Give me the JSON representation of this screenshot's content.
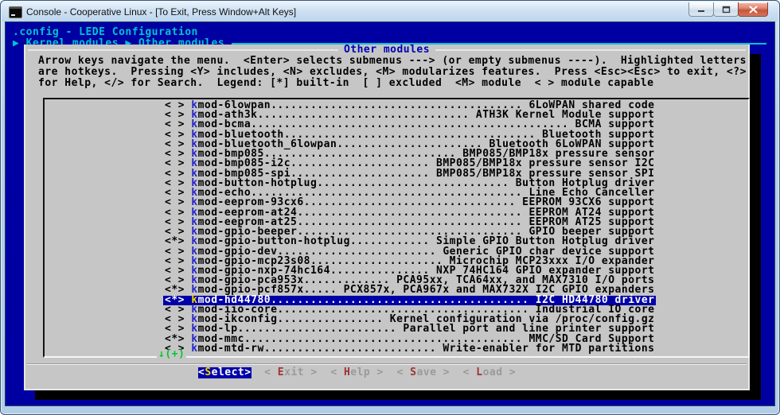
{
  "window": {
    "title": "Console - Cooperative Linux - [To Exit, Press Window+Alt Keys]"
  },
  "console": {
    "backtitle": ".config - LEDE Configuration",
    "breadcrumb": "▶ Kernel modules ▶ Other modules"
  },
  "dialog": {
    "title": "Other modules",
    "instructions": [
      "Arrow keys navigate the menu.  <Enter> selects submenus ---> (or empty submenus ----).  Highlighted letters",
      "are hotkeys.  Pressing <Y> includes, <N> excludes, <M> modularizes features.  Press <Esc><Esc> to exit, <?>",
      "for Help, </> for Search.  Legend: [*] built-in  [ ] excluded  <M> module  < > module capable"
    ],
    "list": {
      "line_width": 74,
      "more_below": "↓(+)",
      "items": [
        {
          "state": "< >",
          "name": "kmod-6lowpan",
          "desc": "6LoWPAN shared code"
        },
        {
          "state": "< >",
          "name": "kmod-ath3k",
          "desc": "ATH3K Kernel Module support"
        },
        {
          "state": "< >",
          "name": "kmod-bcma",
          "desc": "BCMA support"
        },
        {
          "state": "< >",
          "name": "kmod-bluetooth",
          "desc": "Bluetooth support"
        },
        {
          "state": "< >",
          "name": "kmod-bluetooth_6lowpan",
          "desc": "Bluetooth 6LoWPAN support"
        },
        {
          "state": "< >",
          "name": "kmod-bmp085",
          "desc": "BMP085/BMP18x pressure sensor"
        },
        {
          "state": "< >",
          "name": "kmod-bmp085-i2c",
          "desc": "BMP085/BMP18x pressure sensor I2C"
        },
        {
          "state": "< >",
          "name": "kmod-bmp085-spi",
          "desc": "BMP085/BMP18x pressure sensor SPI"
        },
        {
          "state": "< >",
          "name": "kmod-button-hotplug",
          "desc": "Button Hotplug driver"
        },
        {
          "state": "< >",
          "name": "kmod-echo",
          "desc": "Line Echo Canceller"
        },
        {
          "state": "< >",
          "name": "kmod-eeprom-93cx6",
          "desc": "EEPROM 93CX6 support"
        },
        {
          "state": "< >",
          "name": "kmod-eeprom-at24",
          "desc": "EEPROM AT24 support"
        },
        {
          "state": "< >",
          "name": "kmod-eeprom-at25",
          "desc": "EEPROM AT25 support"
        },
        {
          "state": "< >",
          "name": "kmod-gpio-beeper",
          "desc": "GPIO beeper support"
        },
        {
          "state": "<*>",
          "name": "kmod-gpio-button-hotplug",
          "desc": "Simple GPIO Button Hotplug driver"
        },
        {
          "state": "< >",
          "name": "kmod-gpio-dev",
          "desc": "Generic GPIO char device support"
        },
        {
          "state": "< >",
          "name": "kmod-gpio-mcp23s08",
          "desc": "Microchip MCP23xxx I/O expander"
        },
        {
          "state": "< >",
          "name": "kmod-gpio-nxp-74hc164",
          "desc": "NXP 74HC164 GPIO expander support"
        },
        {
          "state": "< >",
          "name": "kmod-gpio-pca953x",
          "desc": "PCA95xx, TCA64xx, and MAX7310 I/O ports"
        },
        {
          "state": "<*>",
          "name": "kmod-gpio-pcf857x",
          "desc": "PCX857x, PCA967x and MAX732X I2C GPIO expanders"
        },
        {
          "state": "<*>",
          "name": "kmod-hd44780",
          "desc": "I2C HD44780 driver",
          "selected": true
        },
        {
          "state": "< >",
          "name": "kmod-iio-core",
          "desc": "Industrial IO core"
        },
        {
          "state": "< >",
          "name": "kmod-ikconfig",
          "desc": "Kernel configuration via /proc/config.gz"
        },
        {
          "state": "< >",
          "name": "kmod-lp",
          "desc": "Parallel port and line printer support"
        },
        {
          "state": "<*>",
          "name": "kmod-mmc",
          "desc": "MMC/SD Card Support"
        },
        {
          "state": "< >",
          "name": "kmod-mtd-rw",
          "desc": "Write-enabler for MTD partitions"
        }
      ]
    },
    "buttons": [
      {
        "name": "select-button",
        "label": "Select",
        "active": true
      },
      {
        "name": "exit-button",
        "label": "Exit",
        "active": false
      },
      {
        "name": "help-button",
        "label": "Help",
        "active": false
      },
      {
        "name": "save-button",
        "label": "Save",
        "active": false
      },
      {
        "name": "load-button",
        "label": "Load",
        "active": false
      }
    ]
  },
  "colors": {
    "console_bg": "#0000a2",
    "cyan": "#00c3d0",
    "dialog_bg": "#c6c6c6",
    "title_blue": "#0000b8",
    "hotkey_blue": "#2525c8",
    "selected_bg": "#0000a8",
    "selected_fg": "#ffffff",
    "hotkey_selected": "#f0dc00",
    "more_green": "#00c832",
    "button_dim": "#9a9a9a",
    "button_hotkey_red": "#a03232"
  }
}
